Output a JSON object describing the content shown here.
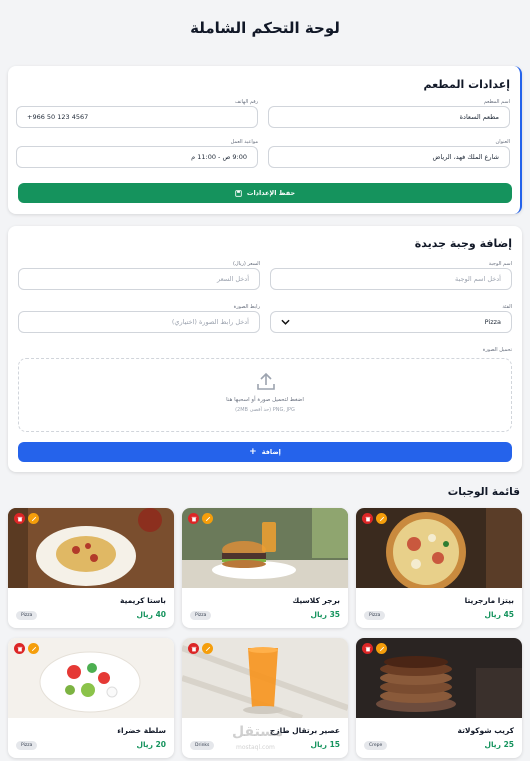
{
  "page": {
    "title": "لوحة التحكم الشاملة"
  },
  "settings": {
    "title": "إعدادات المطعم",
    "name_label": "اسم المطعم",
    "name_value": "مطعم السعادة",
    "phone_label": "رقم الهاتف",
    "phone_value": "+966 50 123 4567",
    "address_label": "العنوان",
    "address_value": "شارع الملك فهد، الرياض",
    "hours_label": "مواعيد العمل",
    "hours_value": "9:00 ص - 11:00 م",
    "save_label": "حفظ الإعدادات"
  },
  "add_meal": {
    "title": "إضافة وجبة جديدة",
    "name_label": "اسم الوجبة",
    "name_placeholder": "أدخل اسم الوجبة",
    "price_label": "السعر (ريال)",
    "price_placeholder": "أدخل السعر",
    "category_label": "الفئة",
    "category_value": "Pizza",
    "image_url_label": "رابط الصورة",
    "image_url_placeholder": "أدخل رابط الصورة (اختياري)",
    "upload_label": "تحميل الصورة",
    "upload_main": "اضغط لتحميل صورة أو اسحبها هنا",
    "upload_hint": "PNG, JPG (حد أقصى 2MB)",
    "add_label": "إضافة"
  },
  "meals_section": {
    "title": "قائمة الوجبات"
  },
  "meals": [
    {
      "name": "بيتزا مارجريتا",
      "price": "45 ريال",
      "category": "Pizza",
      "image": "pizza"
    },
    {
      "name": "برجر كلاسيك",
      "price": "35 ريال",
      "category": "Pizza",
      "image": "burger"
    },
    {
      "name": "باستا كريمية",
      "price": "40 ريال",
      "category": "Pizza",
      "image": "pasta"
    },
    {
      "name": "كريب شوكولاتة",
      "price": "25 ريال",
      "category": "Crepe",
      "image": "crepe"
    },
    {
      "name": "عصير برتقال طازج",
      "price": "15 ريال",
      "category": "Drinks",
      "image": "juice"
    },
    {
      "name": "سلطة خضراء",
      "price": "20 ريال",
      "category": "Pizza",
      "image": "salad"
    }
  ],
  "watermark": {
    "main": "مستقل",
    "sub": "mostaql.com"
  },
  "colors": {
    "primary_green": "#15935d",
    "primary_blue": "#2563eb",
    "delete_red": "#dc2626",
    "edit_orange": "#f59e0b"
  }
}
